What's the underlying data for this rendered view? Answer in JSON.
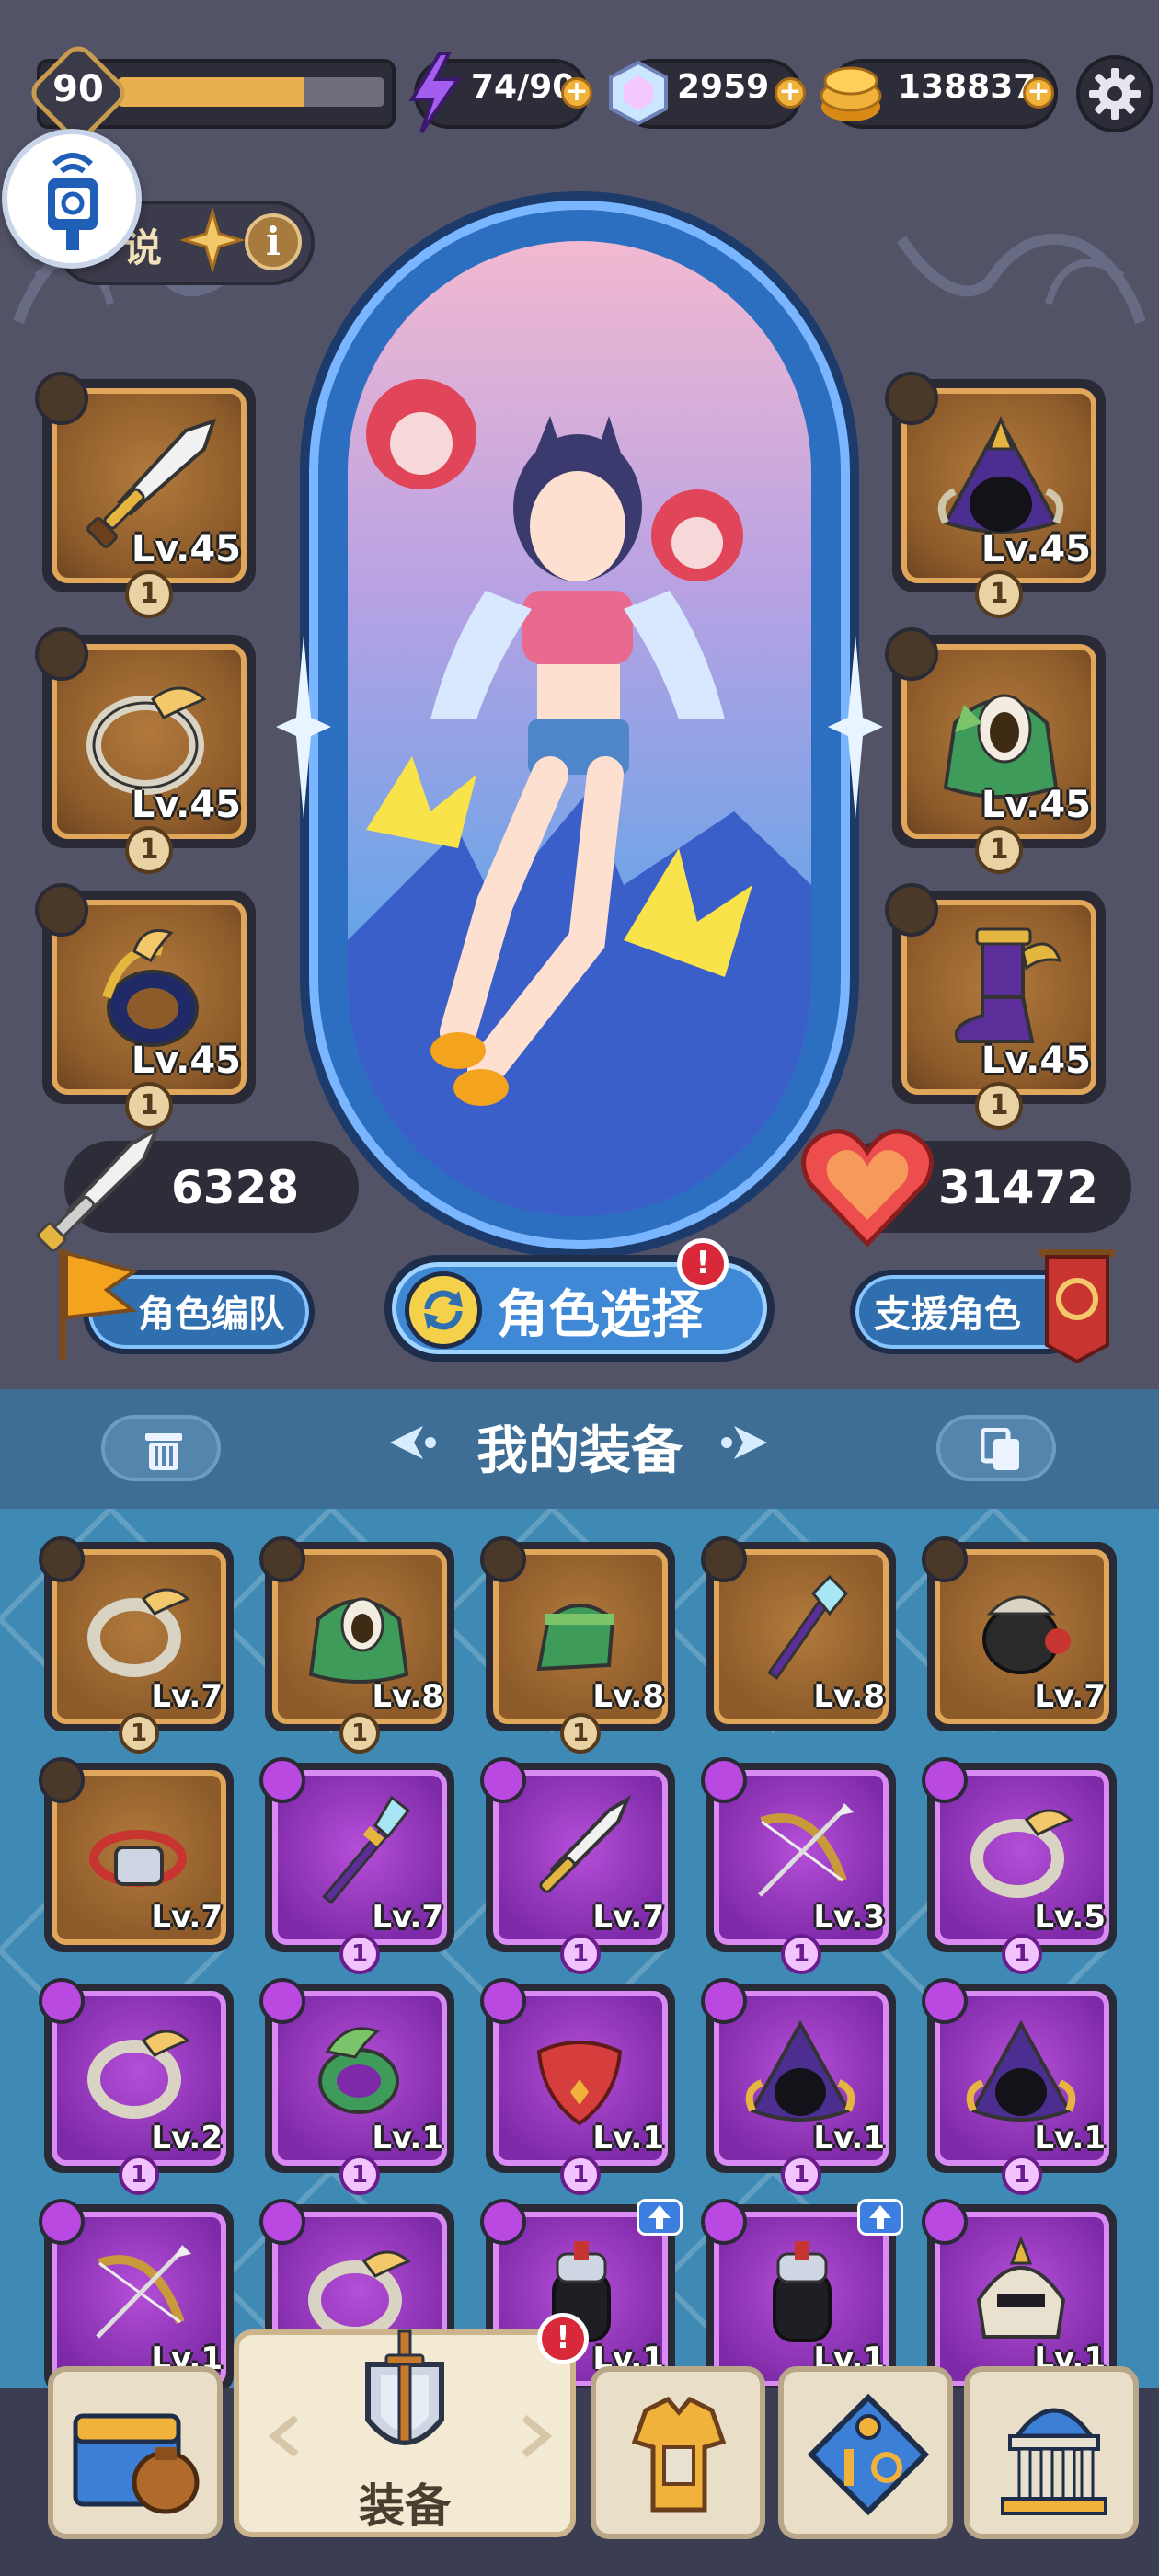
{
  "player": {
    "level": "90",
    "xp_fraction": 0.7
  },
  "resources": {
    "energy": "74/90",
    "gems": "2959",
    "gold": "138837"
  },
  "hero": {
    "class_label": "说",
    "attack": "6328",
    "hp": "31472"
  },
  "equipped": {
    "left": [
      {
        "name": "sword",
        "lv": "Lv.45",
        "count": "1"
      },
      {
        "name": "ring",
        "lv": "Lv.45",
        "count": "1"
      },
      {
        "name": "bracelet",
        "lv": "Lv.45",
        "count": "1"
      }
    ],
    "right": [
      {
        "name": "hood",
        "lv": "Lv.45",
        "count": "1"
      },
      {
        "name": "cloak",
        "lv": "Lv.45",
        "count": "1"
      },
      {
        "name": "boot",
        "lv": "Lv.45",
        "count": "1"
      }
    ]
  },
  "buttons": {
    "team": "角色编队",
    "select": "角色选择",
    "support": "支援角色",
    "select_alert": "!",
    "nav_alert": "!"
  },
  "equipment": {
    "title": "我的装备",
    "items": [
      {
        "name": "ring",
        "rarity": "brown",
        "lv": "Lv.7",
        "count": "1"
      },
      {
        "name": "cloak",
        "rarity": "brown",
        "lv": "Lv.8",
        "count": "1"
      },
      {
        "name": "boot",
        "rarity": "brown",
        "lv": "Lv.8",
        "count": "1"
      },
      {
        "name": "staff",
        "rarity": "brown",
        "lv": "Lv.8",
        "count": ""
      },
      {
        "name": "glove",
        "rarity": "brown",
        "lv": "Lv.7",
        "count": ""
      },
      {
        "name": "belt",
        "rarity": "brown",
        "lv": "Lv.7",
        "count": ""
      },
      {
        "name": "spear",
        "rarity": "purple",
        "lv": "Lv.7",
        "count": "1"
      },
      {
        "name": "sword",
        "rarity": "purple",
        "lv": "Lv.7",
        "count": "1"
      },
      {
        "name": "bow",
        "rarity": "purple",
        "lv": "Lv.3",
        "count": "1"
      },
      {
        "name": "ring",
        "rarity": "purple",
        "lv": "Lv.5",
        "count": "1"
      },
      {
        "name": "ring",
        "rarity": "purple",
        "lv": "Lv.2",
        "count": "1"
      },
      {
        "name": "bracelet",
        "rarity": "purple",
        "lv": "Lv.1",
        "count": "1"
      },
      {
        "name": "scarf",
        "rarity": "purple",
        "lv": "Lv.1",
        "count": "1"
      },
      {
        "name": "hood",
        "rarity": "purple",
        "lv": "Lv.1",
        "count": "1"
      },
      {
        "name": "hood",
        "rarity": "purple",
        "lv": "Lv.1",
        "count": "1"
      },
      {
        "name": "bow",
        "rarity": "purple",
        "lv": "Lv.1",
        "count": ""
      },
      {
        "name": "ring",
        "rarity": "purple",
        "lv": "",
        "count": ""
      },
      {
        "name": "gauntlet",
        "rarity": "purple",
        "lv": "Lv.1",
        "count": ""
      },
      {
        "name": "gauntlet",
        "rarity": "purple",
        "lv": "Lv.1",
        "count": ""
      },
      {
        "name": "helmet",
        "rarity": "purple",
        "lv": "Lv.1",
        "count": ""
      }
    ]
  },
  "nav": {
    "active_label": "装备",
    "items": [
      "treasure-chest-icon",
      "shield-sword-icon",
      "armor-icon",
      "puzzle-icon",
      "palace-icon"
    ]
  },
  "colors": {
    "background": "#535368",
    "gold_border": "#e0a75a",
    "purple_rarity": "#b54fd8",
    "blue_accent": "#3e88d6"
  }
}
